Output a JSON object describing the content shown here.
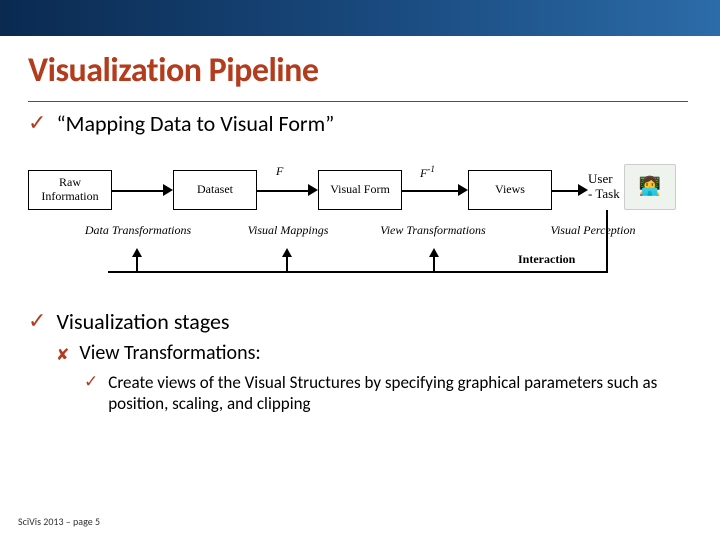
{
  "title": "Visualization Pipeline",
  "bullets": {
    "mapping": "“Mapping Data to Visual Form”",
    "stages": "Visualization stages",
    "sub": "View Transformations:",
    "leaf": "Create views of the Visual Structures by specifying graphical parameters such as position, scaling, and clipping"
  },
  "pipeline": {
    "boxes": {
      "raw": "Raw Information",
      "dataset": "Dataset",
      "visual": "Visual Form",
      "views": "Views"
    },
    "flabels": {
      "f": "F",
      "finv": "F",
      "finv_sup": "-1"
    },
    "below": {
      "data_transformations": "Data Transformations",
      "visual_mappings": "Visual Mappings",
      "view_transformations": "View Transformations",
      "visual_perception": "Visual Perception"
    },
    "user": {
      "label": "User\n- Task",
      "icon": "👩‍💻"
    },
    "interaction": "Interaction"
  },
  "footer": "SciVis 2013 – page 5",
  "marks": {
    "check": "✓",
    "x": "✘"
  }
}
